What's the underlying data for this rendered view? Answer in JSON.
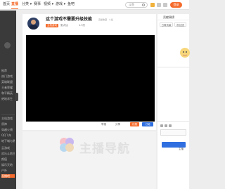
{
  "nav": {
    "items": [
      {
        "label": "首页",
        "active": false
      },
      {
        "label": "直播",
        "active": true
      },
      {
        "label": "分类 ▾",
        "active": false
      },
      {
        "label": "赛事",
        "active": false
      },
      {
        "label": "视频 ▾",
        "active": false
      },
      {
        "label": "游戏 ▾",
        "active": false
      },
      {
        "label": "鱼吧",
        "active": false
      }
    ],
    "search_text": "斗鱼",
    "login_label": "登录",
    "accent": "#f56c2d"
  },
  "sidebar": {
    "items": [
      "推荐",
      "热门游戏",
      "英雄联盟",
      "王者荣耀",
      "和平精英",
      "绝地求生",
      "主机游戏",
      "原神",
      "穿越火线",
      "QQ飞车",
      "地下城与勇士",
      "云游戏",
      "欢乐斗地主",
      "颜值",
      "娱乐天地",
      "户外",
      "直播吧"
    ]
  },
  "room": {
    "title": "这个游戏不需要升级技能",
    "tag": "直播收藏 · 斗鱼",
    "category": "主机游戏",
    "streamer": "张大仙",
    "follow_count": "1.3万",
    "bottom": {
      "left": "举报",
      "share": "分享",
      "gift_label": "礼物",
      "subscribe_label": "订阅"
    }
  },
  "right_panel": {
    "title": "贡献周榜",
    "tabs": [
      "日周贡献",
      "粉丝团"
    ],
    "login_tip": "主播"
  },
  "watermark": {
    "text": "主播导航"
  }
}
